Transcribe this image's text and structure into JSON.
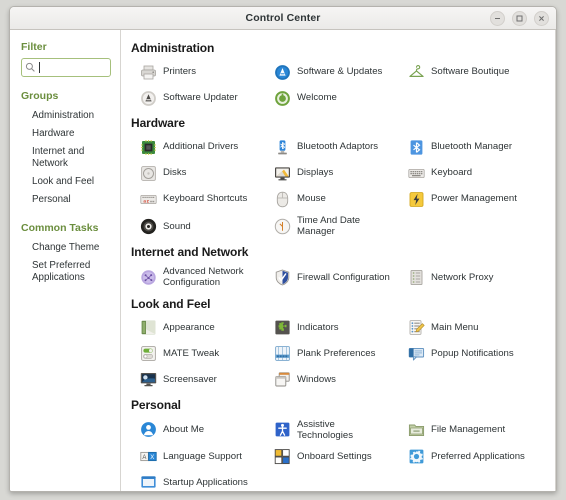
{
  "window": {
    "title": "Control Center",
    "controls": [
      {
        "name": "minimize",
        "glyph": "minimize-icon"
      },
      {
        "name": "maximize",
        "glyph": "maximize-icon"
      },
      {
        "name": "close",
        "glyph": "close-icon"
      }
    ]
  },
  "sidebar": {
    "filter_heading": "Filter",
    "search": {
      "value": "",
      "icon": "search-icon"
    },
    "groups_heading": "Groups",
    "groups": [
      {
        "label": "Administration"
      },
      {
        "label": "Hardware"
      },
      {
        "label": "Internet and Network"
      },
      {
        "label": "Look and Feel"
      },
      {
        "label": "Personal"
      }
    ],
    "common_tasks_heading": "Common Tasks",
    "common_tasks": [
      {
        "label": "Change Theme"
      },
      {
        "label": "Set Preferred Applications"
      }
    ]
  },
  "content": {
    "sections": [
      {
        "title": "Administration",
        "items": [
          {
            "label": "Printers",
            "icon": "printer-icon"
          },
          {
            "label": "Software & Updates",
            "icon": "software-updates-icon"
          },
          {
            "label": "Software Boutique",
            "icon": "clothes-hanger-icon"
          },
          {
            "label": "Software Updater",
            "icon": "software-updater-icon"
          },
          {
            "label": "Welcome",
            "icon": "welcome-icon"
          }
        ]
      },
      {
        "title": "Hardware",
        "items": [
          {
            "label": "Additional Drivers",
            "icon": "cpu-chip-icon"
          },
          {
            "label": "Bluetooth Adaptors",
            "icon": "bluetooth-adaptor-icon"
          },
          {
            "label": "Bluetooth Manager",
            "icon": "bluetooth-manager-icon"
          },
          {
            "label": "Disks",
            "icon": "disk-icon"
          },
          {
            "label": "Displays",
            "icon": "display-monitor-icon"
          },
          {
            "label": "Keyboard",
            "icon": "keyboard-icon"
          },
          {
            "label": "Keyboard Shortcuts",
            "icon": "keyboard-shortcuts-icon"
          },
          {
            "label": "Mouse",
            "icon": "mouse-icon"
          },
          {
            "label": "Power Management",
            "icon": "power-bolt-icon"
          },
          {
            "label": "Sound",
            "icon": "speaker-icon"
          },
          {
            "label": "Time And Date Manager",
            "icon": "clock-icon"
          }
        ]
      },
      {
        "title": "Internet and Network",
        "items": [
          {
            "label": "Advanced Network Configuration",
            "icon": "network-globe-icon",
            "wrap": true
          },
          {
            "label": "Firewall Configuration",
            "icon": "shield-icon"
          },
          {
            "label": "Network Proxy",
            "icon": "network-proxy-icon"
          }
        ]
      },
      {
        "title": "Look and Feel",
        "items": [
          {
            "label": "Appearance",
            "icon": "appearance-icon"
          },
          {
            "label": "Indicators",
            "icon": "puzzle-piece-icon"
          },
          {
            "label": "Main Menu",
            "icon": "main-menu-icon"
          },
          {
            "label": "MATE Tweak",
            "icon": "toggle-switch-icon"
          },
          {
            "label": "Plank Preferences",
            "icon": "plank-dock-icon"
          },
          {
            "label": "Popup Notifications",
            "icon": "notification-bubble-icon"
          },
          {
            "label": "Screensaver",
            "icon": "screensaver-icon"
          },
          {
            "label": "Windows",
            "icon": "windows-stack-icon"
          }
        ]
      },
      {
        "title": "Personal",
        "items": [
          {
            "label": "About Me",
            "icon": "user-avatar-icon"
          },
          {
            "label": "Assistive Technologies",
            "icon": "accessibility-icon"
          },
          {
            "label": "File Management",
            "icon": "folder-icon"
          },
          {
            "label": "Language Support",
            "icon": "language-icon"
          },
          {
            "label": "Onboard Settings",
            "icon": "onboard-keyboard-icon"
          },
          {
            "label": "Preferred Applications",
            "icon": "gear-icon"
          },
          {
            "label": "Startup Applications",
            "icon": "startup-window-icon"
          }
        ]
      }
    ]
  },
  "colors": {
    "accent_green": "#6b8e3e",
    "search_border": "#a6c07c",
    "text": "#2e3436",
    "titlebar": "#efeeec"
  }
}
